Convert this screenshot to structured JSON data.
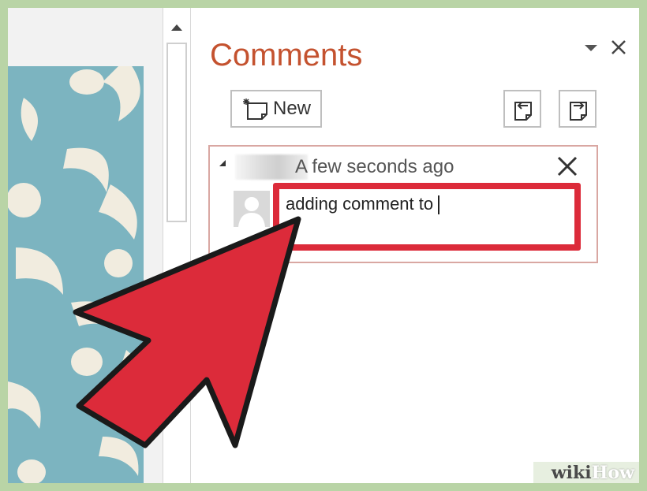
{
  "panel": {
    "title": "Comments",
    "new_label": "New"
  },
  "comment": {
    "timestamp": "A few seconds ago",
    "text": "adding comment to"
  },
  "watermark": {
    "wiki": "wiki",
    "how": "How"
  },
  "icons": {
    "dropdown": "chevron-down-icon",
    "close": "close-icon",
    "new_comment": "new-comment-icon",
    "previous": "previous-comment-icon",
    "next": "next-comment-icon",
    "collapse": "collapse-arrow-icon",
    "delete": "close-icon",
    "avatar": "user-silhouette-icon",
    "pointer": "arrow-pointer-icon"
  },
  "colors": {
    "title": "#c4522f",
    "highlight": "#dc2b3a",
    "card_border": "#d9a7a2",
    "slide_background": "#7cb4c0",
    "slide_shapes": "#f1ecdf",
    "frame": "#b9d4a6"
  }
}
